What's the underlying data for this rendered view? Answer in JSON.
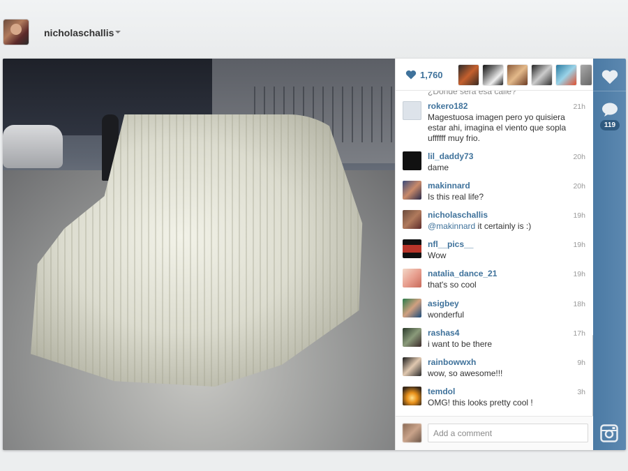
{
  "header": {
    "username": "nicholaschallis"
  },
  "post": {
    "like_count": "1,760",
    "comment_count": "119",
    "partial_comment_text": "¿Dónde será esa calle?",
    "comments": [
      {
        "user": "rokero182",
        "time": "21h",
        "text": "Magestuosa imagen pero yo quisiera estar ahi, imagina el viento que sopla uffffff muy frio."
      },
      {
        "user": "lil_daddy73",
        "time": "20h",
        "text": "dame"
      },
      {
        "user": "makinnard",
        "time": "20h",
        "text": "Is this real life?"
      },
      {
        "user": "nicholaschallis",
        "time": "19h",
        "mention": "@makinnard",
        "text": " it certainly is :)"
      },
      {
        "user": "nfl__pics__",
        "time": "19h",
        "text": "Wow"
      },
      {
        "user": "natalia_dance_21",
        "time": "19h",
        "text": "that's so cool"
      },
      {
        "user": "asigbey",
        "time": "18h",
        "text": "wonderful"
      },
      {
        "user": "rashas4",
        "time": "17h",
        "text": "i want to be there"
      },
      {
        "user": "rainbowwxh",
        "time": "9h",
        "text": "wow, so awesome!!!"
      },
      {
        "user": "temdol",
        "time": "3h",
        "text": "OMG! this looks pretty cool !"
      }
    ]
  },
  "comment_input": {
    "placeholder": "Add a comment"
  },
  "colors": {
    "accent": "#3f729b",
    "sidebar": "#517fa4",
    "background": "#eceeef"
  },
  "icons": {
    "like": "heart-icon",
    "comment": "speech-bubble-icon",
    "brand": "instagram-camera-icon",
    "menu": "caret-down-icon"
  }
}
